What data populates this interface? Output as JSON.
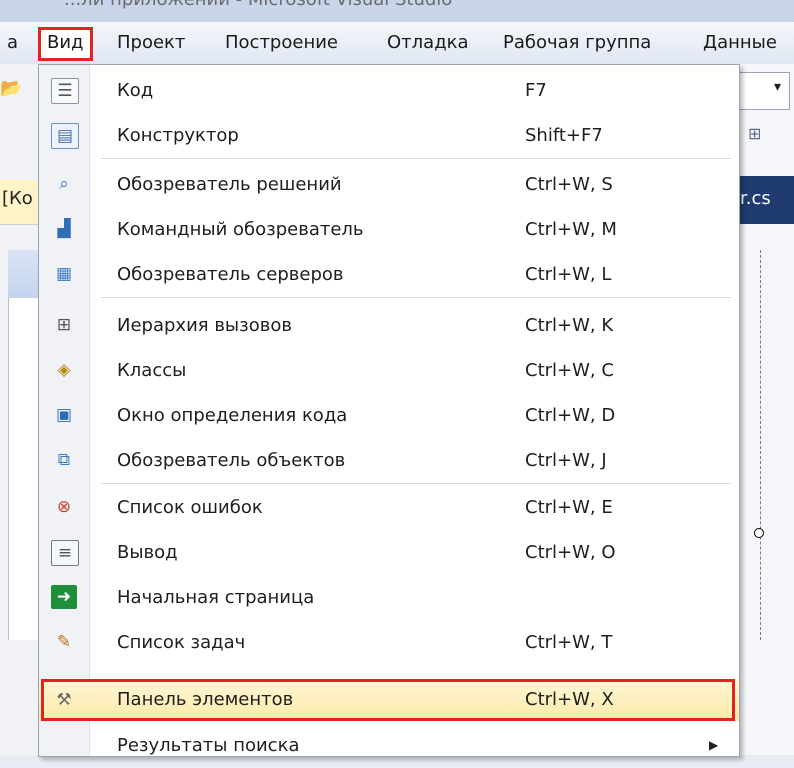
{
  "title_fragment": "...ли приложений - Microsoft Visual Studio",
  "menubar": {
    "items": [
      {
        "label": "а"
      },
      {
        "label": "Вид"
      },
      {
        "label": "Проект"
      },
      {
        "label": "Построение"
      },
      {
        "label": "Отладка"
      },
      {
        "label": "Рабочая группа"
      },
      {
        "label": "Данные"
      }
    ]
  },
  "background": {
    "left_tab": "[Ко",
    "right_tab": "r.cs",
    "combo_arrow": "▾"
  },
  "menu": {
    "items": [
      {
        "icon": "code-icon",
        "label": "Код",
        "shortcut": "F7"
      },
      {
        "icon": "designer-icon",
        "label": "Конструктор",
        "shortcut": "Shift+F7"
      },
      {
        "icon": "solution-explorer-icon",
        "label": "Обозреватель решений",
        "shortcut": "Ctrl+W, S"
      },
      {
        "icon": "team-explorer-icon",
        "label": "Командный обозреватель",
        "shortcut": "Ctrl+W, M"
      },
      {
        "icon": "server-explorer-icon",
        "label": "Обозреватель серверов",
        "shortcut": "Ctrl+W, L"
      },
      {
        "icon": "call-hierarchy-icon",
        "label": "Иерархия вызовов",
        "shortcut": "Ctrl+W, K"
      },
      {
        "icon": "classes-icon",
        "label": "Классы",
        "shortcut": "Ctrl+W, C"
      },
      {
        "icon": "code-definition-icon",
        "label": "Окно определения кода",
        "shortcut": "Ctrl+W, D"
      },
      {
        "icon": "object-browser-icon",
        "label": "Обозреватель объектов",
        "shortcut": "Ctrl+W, J"
      },
      {
        "icon": "error-list-icon",
        "label": "Список ошибок",
        "shortcut": "Ctrl+W, E"
      },
      {
        "icon": "output-icon",
        "label": "Вывод",
        "shortcut": "Ctrl+W, O"
      },
      {
        "icon": "start-page-icon",
        "label": "Начальная страница",
        "shortcut": ""
      },
      {
        "icon": "task-list-icon",
        "label": "Список задач",
        "shortcut": "Ctrl+W, T"
      },
      {
        "icon": "toolbox-icon",
        "label": "Панель элементов",
        "shortcut": "Ctrl+W, X",
        "highlighted": true
      },
      {
        "icon": "find-results-icon",
        "label": "Результаты поиска",
        "shortcut": "",
        "submenu": true
      }
    ]
  },
  "colors": {
    "highlight_border": "#e32222",
    "highlight_fill": "#fde9a6"
  }
}
